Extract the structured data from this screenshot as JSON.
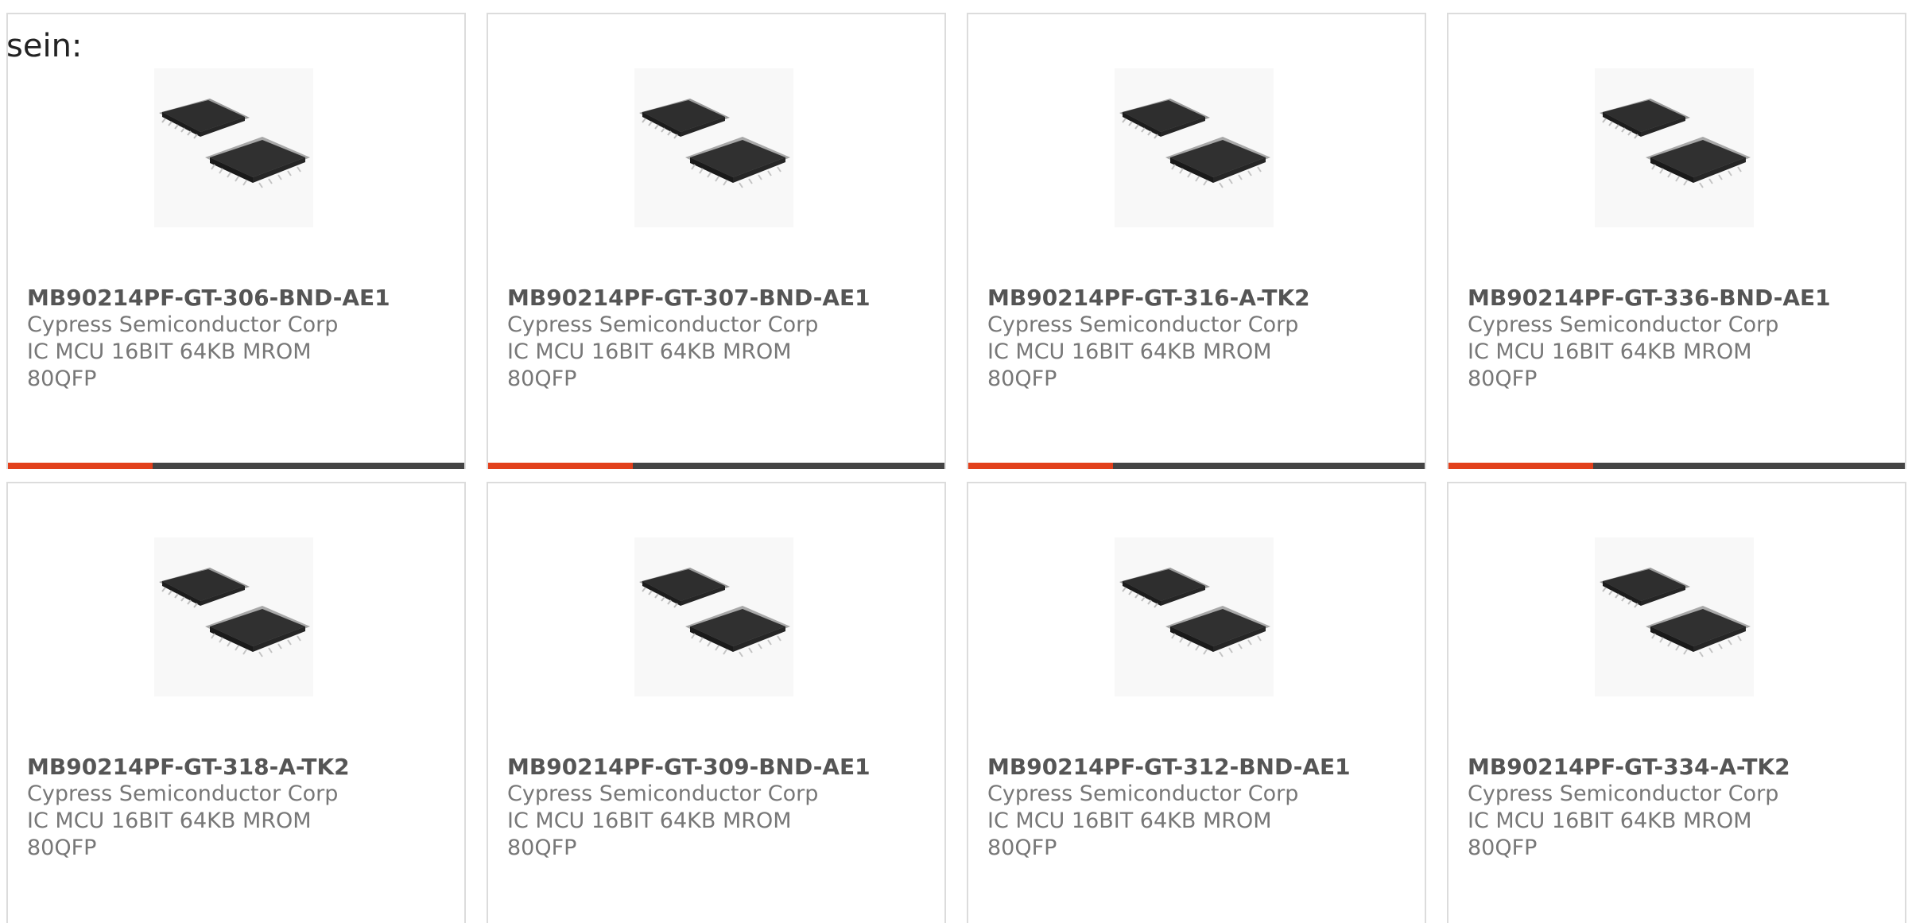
{
  "heading": "sein:",
  "colors": {
    "accent_bar": "#e2401c",
    "dark_bar": "#444444",
    "card_border": "#dcdcdc"
  },
  "product_image_icon": "ic-chip-qfp-image",
  "products": [
    {
      "part_number": "MB90214PF-GT-306-BND-AE1",
      "manufacturer": "Cypress Semiconductor Corp",
      "description_line1": "IC MCU 16BIT 64KB MROM",
      "description_line2": "80QFP"
    },
    {
      "part_number": "MB90214PF-GT-307-BND-AE1",
      "manufacturer": "Cypress Semiconductor Corp",
      "description_line1": "IC MCU 16BIT 64KB MROM",
      "description_line2": "80QFP"
    },
    {
      "part_number": "MB90214PF-GT-316-A-TK2",
      "manufacturer": "Cypress Semiconductor Corp",
      "description_line1": "IC MCU 16BIT 64KB MROM",
      "description_line2": "80QFP"
    },
    {
      "part_number": "MB90214PF-GT-336-BND-AE1",
      "manufacturer": "Cypress Semiconductor Corp",
      "description_line1": "IC MCU 16BIT 64KB MROM",
      "description_line2": "80QFP"
    },
    {
      "part_number": "MB90214PF-GT-318-A-TK2",
      "manufacturer": "Cypress Semiconductor Corp",
      "description_line1": "IC MCU 16BIT 64KB MROM",
      "description_line2": "80QFP"
    },
    {
      "part_number": "MB90214PF-GT-309-BND-AE1",
      "manufacturer": "Cypress Semiconductor Corp",
      "description_line1": "IC MCU 16BIT 64KB MROM",
      "description_line2": "80QFP"
    },
    {
      "part_number": "MB90214PF-GT-312-BND-AE1",
      "manufacturer": "Cypress Semiconductor Corp",
      "description_line1": "IC MCU 16BIT 64KB MROM",
      "description_line2": "80QFP"
    },
    {
      "part_number": "MB90214PF-GT-334-A-TK2",
      "manufacturer": "Cypress Semiconductor Corp",
      "description_line1": "IC MCU 16BIT 64KB MROM",
      "description_line2": "80QFP"
    }
  ]
}
